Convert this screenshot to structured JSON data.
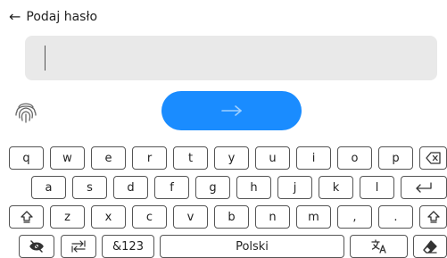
{
  "header": {
    "back_icon": "←",
    "title": "Podaj hasło"
  },
  "password": {
    "value": "",
    "placeholder": ""
  },
  "icons": {
    "fingerprint": "fingerprint-icon",
    "submit": "arrow-right-icon",
    "backspace": "backspace-icon",
    "enter": "enter-icon",
    "shift": "shift-icon",
    "hide": "eye-off-icon",
    "tab": "tab-icon",
    "translate": "translate-icon",
    "eraser": "eraser-icon"
  },
  "colors": {
    "accent": "#1a8cff",
    "field_bg": "#e9e9e9"
  },
  "keyboard": {
    "row1": [
      "q",
      "w",
      "e",
      "r",
      "t",
      "y",
      "u",
      "i",
      "o",
      "p"
    ],
    "row2": [
      "a",
      "s",
      "d",
      "f",
      "g",
      "h",
      "j",
      "k",
      "l"
    ],
    "row3": [
      "z",
      "x",
      "c",
      "v",
      "b",
      "n",
      "m",
      ",",
      "."
    ],
    "numbers_label": "&123",
    "space_label": "Polski"
  }
}
